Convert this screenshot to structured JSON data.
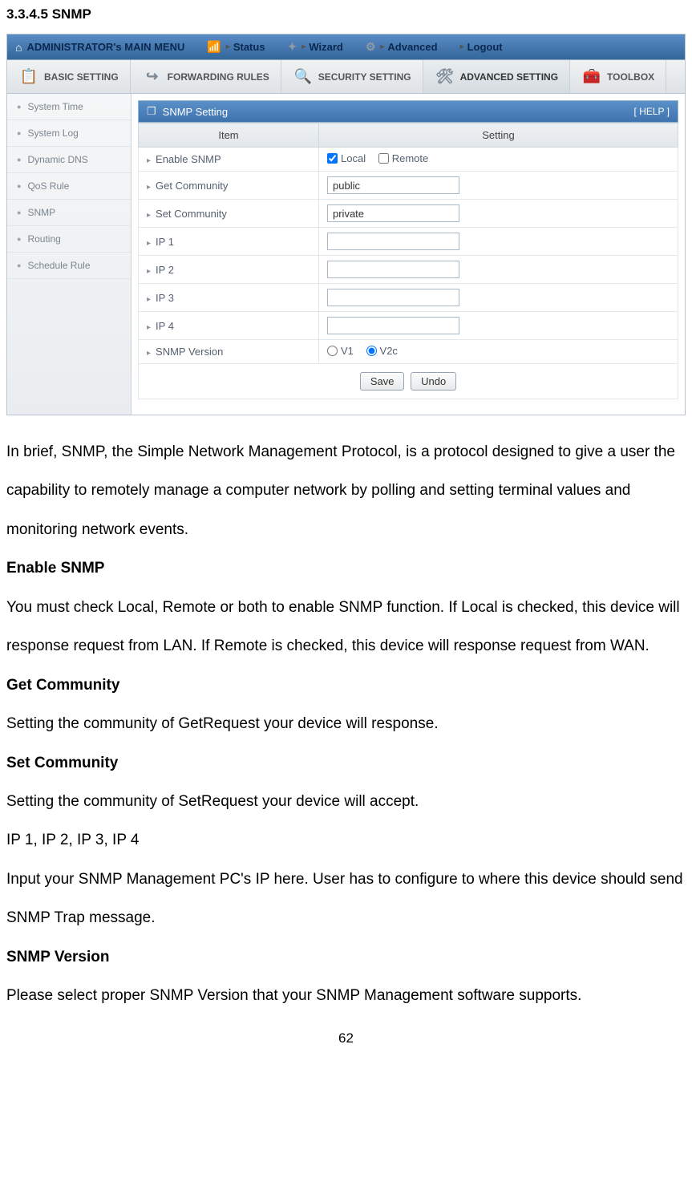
{
  "section_heading": "3.3.4.5 SNMP",
  "top_nav": {
    "home": "ADMINISTRATOR's MAIN MENU",
    "items": [
      "Status",
      "Wizard",
      "Advanced",
      "Logout"
    ]
  },
  "sub_nav": {
    "items": [
      "BASIC SETTING",
      "FORWARDING RULES",
      "SECURITY SETTING",
      "ADVANCED SETTING",
      "TOOLBOX"
    ],
    "active_index": 3
  },
  "sidebar": {
    "items": [
      "System Time",
      "System Log",
      "Dynamic DNS",
      "QoS Rule",
      "SNMP",
      "Routing",
      "Schedule Rule"
    ]
  },
  "panel": {
    "title": "SNMP Setting",
    "help": "[ HELP ]",
    "headers": {
      "item": "Item",
      "setting": "Setting"
    },
    "rows": {
      "enable_snmp": {
        "label": "Enable SNMP",
        "local": "Local",
        "local_checked": true,
        "remote": "Remote",
        "remote_checked": false
      },
      "get_community": {
        "label": "Get Community",
        "value": "public"
      },
      "set_community": {
        "label": "Set Community",
        "value": "private"
      },
      "ip1": {
        "label": "IP 1",
        "value": ""
      },
      "ip2": {
        "label": "IP 2",
        "value": ""
      },
      "ip3": {
        "label": "IP 3",
        "value": ""
      },
      "ip4": {
        "label": "IP 4",
        "value": ""
      },
      "snmp_version": {
        "label": "SNMP Version",
        "v1": "V1",
        "v1_selected": false,
        "v2c": "V2c",
        "v2c_selected": true
      }
    },
    "buttons": {
      "save": "Save",
      "undo": "Undo"
    }
  },
  "doc": {
    "intro": "In brief, SNMP, the Simple Network Management Protocol, is a protocol designed to give a user the capability to remotely manage a computer network by polling and setting terminal values and monitoring network events.",
    "h_enable": "Enable SNMP",
    "p_enable": "You must check Local, Remote or both to enable SNMP function. If Local is checked, this device will response request from LAN. If Remote is checked, this device will response request from WAN.",
    "h_get": "Get Community",
    "p_get": "Setting the community of GetRequest your device will response.",
    "h_set": "Set Community",
    "p_set": "Setting the community of SetRequest your device will accept.",
    "h_ip": "IP 1, IP 2, IP 3, IP 4",
    "p_ip": "Input your SNMP Management PC's IP here. User has to configure to where this device should send SNMP Trap message.",
    "h_ver": "SNMP Version",
    "p_ver": "Please select proper SNMP Version that your SNMP Management software supports."
  },
  "page_number": "62"
}
